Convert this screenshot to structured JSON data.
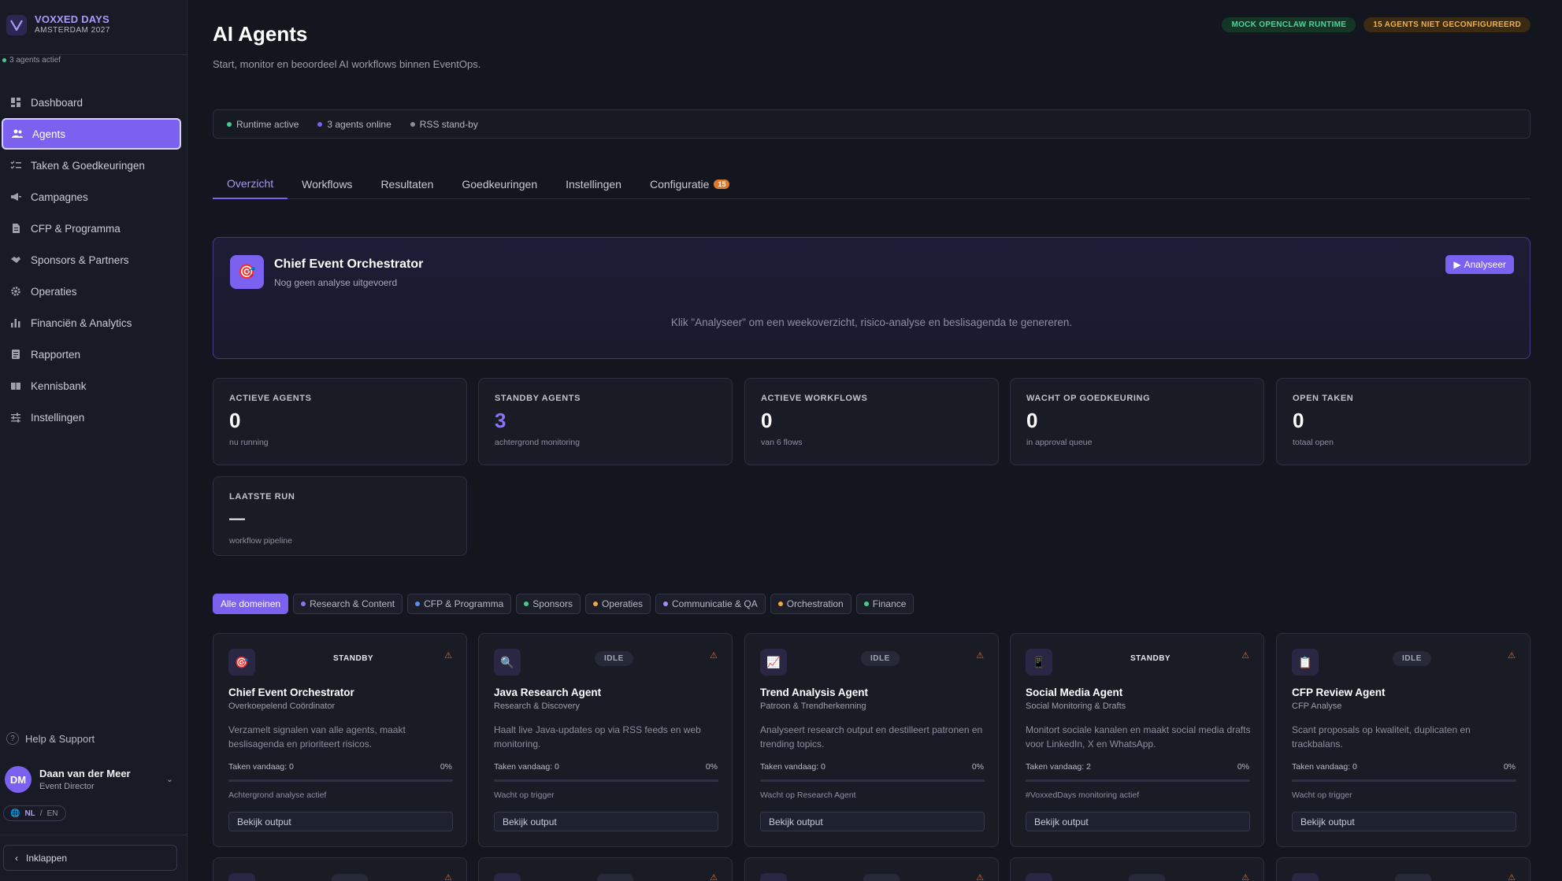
{
  "brand": {
    "name": "VOXXED DAYS",
    "sub": "AMSTERDAM 2027"
  },
  "agents_active": "3 agents actief",
  "nav": [
    {
      "label": "Dashboard",
      "icon": "dashboard-icon"
    },
    {
      "label": "Agents",
      "icon": "users-icon",
      "active": true
    },
    {
      "label": "Taken & Goedkeuringen",
      "icon": "checklist-icon"
    },
    {
      "label": "Campagnes",
      "icon": "megaphone-icon"
    },
    {
      "label": "CFP & Programma",
      "icon": "document-icon"
    },
    {
      "label": "Sponsors & Partners",
      "icon": "handshake-icon"
    },
    {
      "label": "Operaties",
      "icon": "gear-icon"
    },
    {
      "label": "Financiën & Analytics",
      "icon": "bar-chart-icon"
    },
    {
      "label": "Rapporten",
      "icon": "report-icon"
    },
    {
      "label": "Kennisbank",
      "icon": "book-icon"
    },
    {
      "label": "Instellingen",
      "icon": "sliders-icon"
    }
  ],
  "help": "Help & Support",
  "user": {
    "initials": "DM",
    "name": "Daan van der Meer",
    "role": "Event Director"
  },
  "lang": {
    "active": "NL",
    "sep": "/",
    "other": "EN"
  },
  "collapse": "Inklappen",
  "page": {
    "title": "AI Agents",
    "subtitle": "Start, monitor en beoordeel AI workflows binnen EventOps."
  },
  "badges": {
    "runtime": "MOCK OPENCLAW RUNTIME",
    "unconfigured": "15 AGENTS NIET GECONFIGUREERD"
  },
  "status": [
    {
      "label": "Runtime active",
      "color": "#3ecf8e"
    },
    {
      "label": "3 agents online",
      "color": "#7b61f0"
    },
    {
      "label": "RSS stand-by",
      "color": "#8a8c9a"
    }
  ],
  "tabs": [
    {
      "label": "Overzicht",
      "active": true
    },
    {
      "label": "Workflows"
    },
    {
      "label": "Resultaten"
    },
    {
      "label": "Goedkeuringen"
    },
    {
      "label": "Instellingen"
    },
    {
      "label": "Configuratie",
      "count": "15"
    }
  ],
  "orchestrator": {
    "title": "Chief Event Orchestrator",
    "subtitle": "Nog geen analyse uitgevoerd",
    "button": "Analyseer",
    "hint": "Klik \"Analyseer\" om een weekoverzicht, risico-analyse en beslisagenda te genereren."
  },
  "stats": [
    {
      "label": "ACTIEVE AGENTS",
      "value": "0",
      "sub": "nu running"
    },
    {
      "label": "STANDBY AGENTS",
      "value": "3",
      "sub": "achtergrond monitoring",
      "accent": "#8b73f5"
    },
    {
      "label": "ACTIEVE WORKFLOWS",
      "value": "0",
      "sub": "van 6 flows"
    },
    {
      "label": "WACHT OP GOEDKEURING",
      "value": "0",
      "sub": "in approval queue"
    },
    {
      "label": "OPEN TAKEN",
      "value": "0",
      "sub": "totaal open"
    },
    {
      "label": "LAATSTE RUN",
      "value": "—",
      "sub": "workflow pipeline"
    }
  ],
  "filters": [
    {
      "label": "Alle domeinen",
      "active": true
    },
    {
      "label": "Research & Content",
      "color": "#8b73f5"
    },
    {
      "label": "CFP & Programma",
      "color": "#5b8def"
    },
    {
      "label": "Sponsors",
      "color": "#3ecf8e"
    },
    {
      "label": "Operaties",
      "color": "#f0a83a"
    },
    {
      "label": "Communicatie & QA",
      "color": "#a88cf7"
    },
    {
      "label": "Orchestration",
      "color": "#f0a83a"
    },
    {
      "label": "Finance",
      "color": "#3ecf8e"
    }
  ],
  "agents": [
    {
      "icon": "🎯",
      "status": "STANDBY",
      "title": "Chief Event Orchestrator",
      "sub": "Overkoepelend Coördinator",
      "desc": "Verzamelt signalen van alle agents, maakt beslisagenda en prioriteert risicos.",
      "tasks": "Taken vandaag: 0",
      "pct": "0%",
      "note": "Achtergrond analyse actief",
      "button": "Bekijk output"
    },
    {
      "icon": "🔍",
      "status": "IDLE",
      "title": "Java Research Agent",
      "sub": "Research & Discovery",
      "desc": "Haalt live Java-updates op via RSS feeds en web monitoring.",
      "tasks": "Taken vandaag: 0",
      "pct": "0%",
      "note": "Wacht op trigger",
      "button": "Bekijk output"
    },
    {
      "icon": "📈",
      "status": "IDLE",
      "title": "Trend Analysis Agent",
      "sub": "Patroon & Trendherkenning",
      "desc": "Analyseert research output en destilleert patronen en trending topics.",
      "tasks": "Taken vandaag: 0",
      "pct": "0%",
      "note": "Wacht op Research Agent",
      "button": "Bekijk output"
    },
    {
      "icon": "📱",
      "status": "STANDBY",
      "title": "Social Media Agent",
      "sub": "Social Monitoring & Drafts",
      "desc": "Monitort sociale kanalen en maakt social media drafts voor LinkedIn, X en WhatsApp.",
      "tasks": "Taken vandaag: 2",
      "pct": "0%",
      "note": "#VoxxedDays monitoring actief",
      "button": "Bekijk output"
    },
    {
      "icon": "📋",
      "status": "IDLE",
      "title": "CFP Review Agent",
      "sub": "CFP Analyse",
      "desc": "Scant proposals op kwaliteit, duplicaten en trackbalans.",
      "tasks": "Taken vandaag: 0",
      "pct": "0%",
      "note": "Wacht op trigger",
      "button": "Bekijk output"
    }
  ]
}
